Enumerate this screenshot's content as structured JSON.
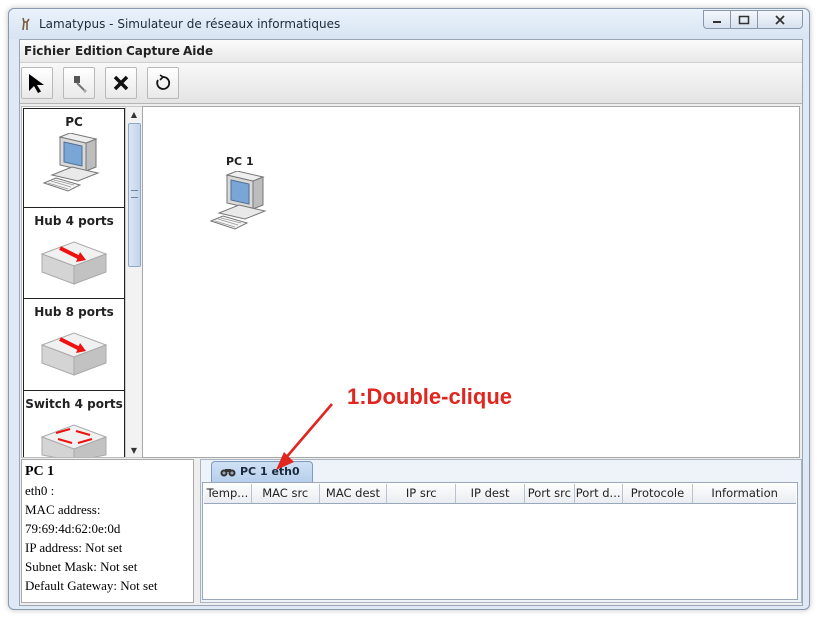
{
  "window": {
    "title": "Lamatypus - Simulateur de réseaux informatiques",
    "buttons": [
      "minimize",
      "maximize",
      "close"
    ]
  },
  "menu": [
    "Fichier",
    "Edition",
    "Capture",
    "Aide"
  ],
  "toolbar": {
    "tools": [
      {
        "name": "select-tool",
        "icon": "arrow-pointer-icon"
      },
      {
        "name": "cable-tool",
        "icon": "cable-plug-icon"
      },
      {
        "name": "delete-tool",
        "icon": "delete-x-icon"
      },
      {
        "name": "reset-tool",
        "icon": "refresh-icon"
      }
    ]
  },
  "palette": {
    "items": [
      {
        "label": "PC",
        "icon": "pc-icon"
      },
      {
        "label": "Hub 4 ports",
        "icon": "hub-icon"
      },
      {
        "label": "Hub 8 ports",
        "icon": "hub-icon"
      },
      {
        "label": "Switch 4 ports",
        "icon": "switch-icon"
      }
    ]
  },
  "canvas": {
    "nodes": [
      {
        "label": "PC 1",
        "icon": "pc-icon"
      }
    ]
  },
  "info_panel": {
    "title": "PC 1",
    "interface": "eth0 :",
    "mac_label": "MAC address:",
    "mac_value": "79:69:4d:62:0e:0d",
    "ip": "IP address: Not set",
    "mask": "Subnet Mask: Not set",
    "gateway": "Default Gateway: Not set"
  },
  "capture": {
    "tab_label": "PC 1 eth0",
    "columns": [
      "Temp...",
      "MAC src",
      "MAC dest",
      "IP src",
      "IP dest",
      "Port src",
      "Port d...",
      "Protocole",
      "Information"
    ],
    "rows": []
  },
  "annotation": {
    "text": "1:Double-clique",
    "color": "#e0261f"
  }
}
